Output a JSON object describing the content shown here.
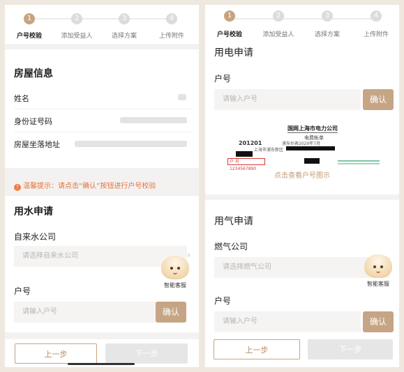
{
  "steps": [
    "户号校验",
    "添加受益人",
    "选择方案",
    "上传附件"
  ],
  "step_numbers": [
    "1",
    "2",
    "3",
    "4"
  ],
  "left": {
    "housing": {
      "title": "房屋信息",
      "name_label": "姓名",
      "id_label": "身份证号码",
      "address_label": "房屋坐落地址"
    },
    "notice": "温馨提示：请点击“确认”按钮进行户号校验",
    "water": {
      "title": "用水申请",
      "company_label": "自来水公司",
      "company_placeholder": "请选择自来水公司",
      "account_label": "户号",
      "account_placeholder": "请输入户号",
      "confirm": "确认"
    },
    "buttons": {
      "prev": "上一步",
      "next": "下一步"
    }
  },
  "right": {
    "electric": {
      "title": "用电申请",
      "account_label": "户号",
      "account_placeholder": "请输入户号",
      "confirm": "确认",
      "bill": {
        "title": "国网上海市电力公司",
        "subtitle": "电费帐单",
        "number": "201201",
        "address": "上海市浦东新区",
        "period": "浦东抄表2020年7月",
        "box_text": "户 号 1234567890"
      },
      "view_example": "点击查看户号图示"
    },
    "gas": {
      "title": "用气申请",
      "company_label": "燃气公司",
      "company_placeholder": "请选择燃气公司",
      "account_label": "户号",
      "account_placeholder": "请输入户号",
      "confirm": "确认"
    },
    "buttons": {
      "prev": "上一步",
      "next": "下一步"
    }
  },
  "assistant_label": "智能客服",
  "colors": {
    "accent": "#c6a585",
    "notice": "#e0733f",
    "disabled": "#e6e6e6"
  }
}
